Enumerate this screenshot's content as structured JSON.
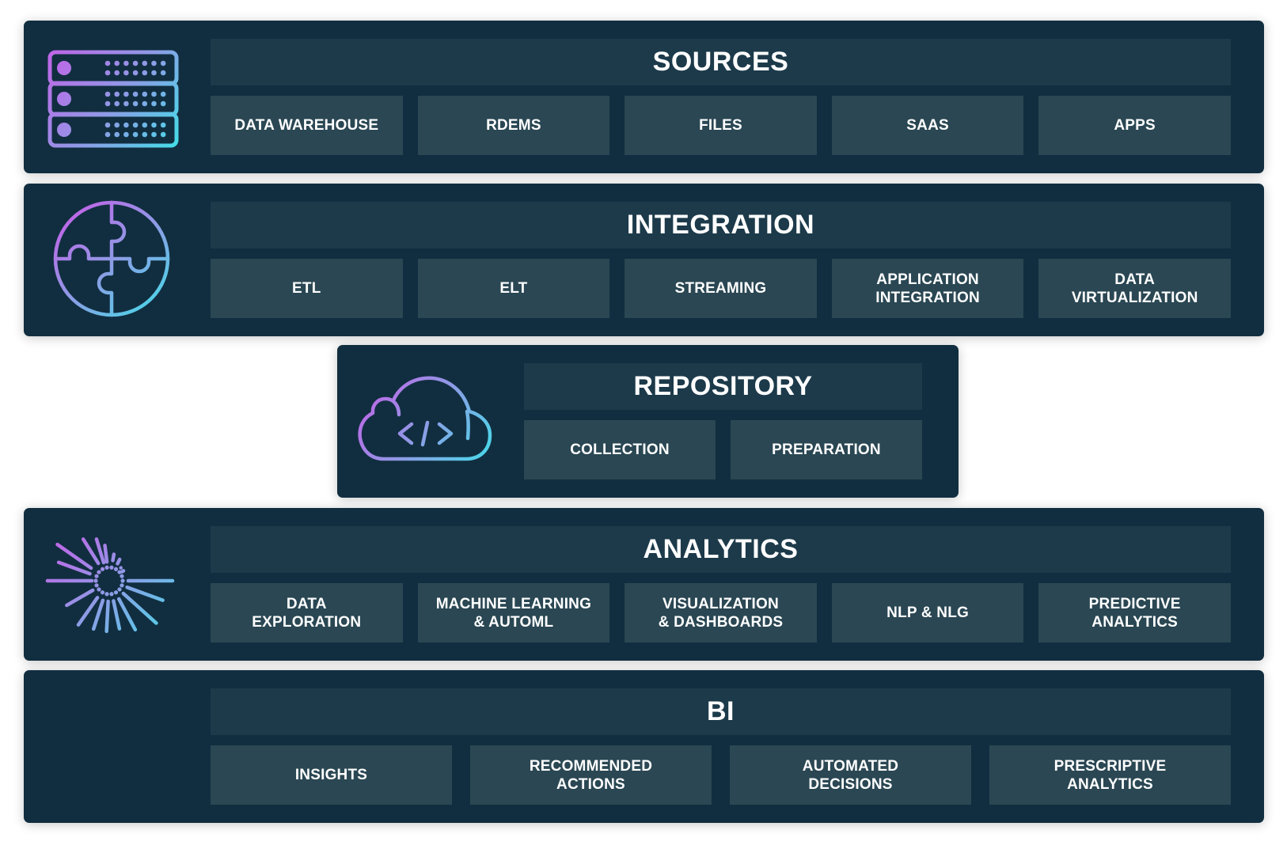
{
  "colors": {
    "panel_bg": "#112e40",
    "title_bar_bg": "#1c3a4a",
    "tile_bg": "#2a4753",
    "text": "#ffffff",
    "icon_gradient_start": "#c65ee8",
    "icon_gradient_mid": "#8f9ae6",
    "icon_gradient_end": "#45dbe8",
    "page_bg": "#ffffff"
  },
  "layers": {
    "sources": {
      "title": "SOURCES",
      "icon": "server-rack-icon",
      "items": [
        "DATA WAREHOUSE",
        "RDEMS",
        "FILES",
        "SAAS",
        "APPS"
      ]
    },
    "integration": {
      "title": "INTEGRATION",
      "icon": "puzzle-icon",
      "items": [
        "ETL",
        "ELT",
        "STREAMING",
        "APPLICATION\nINTEGRATION",
        "DATA\nVIRTUALIZATION"
      ]
    },
    "repository": {
      "title": "REPOSITORY",
      "icon": "cloud-code-icon",
      "items": [
        "COLLECTION",
        "PREPARATION"
      ]
    },
    "analytics": {
      "title": "ANALYTICS",
      "icon": "starburst-icon",
      "items": [
        "DATA\nEXPLORATION",
        "MACHINE LEARNING\n& AUTOML",
        "VISUALIZATION\n& DASHBOARDS",
        "NLP & NLG",
        "PREDICTIVE\nANALYTICS"
      ]
    },
    "bi": {
      "title": "BI",
      "items": [
        "INSIGHTS",
        "RECOMMENDED\nACTIONS",
        "AUTOMATED\nDECISIONS",
        "PRESCRIPTIVE\nANALYTICS"
      ]
    }
  }
}
